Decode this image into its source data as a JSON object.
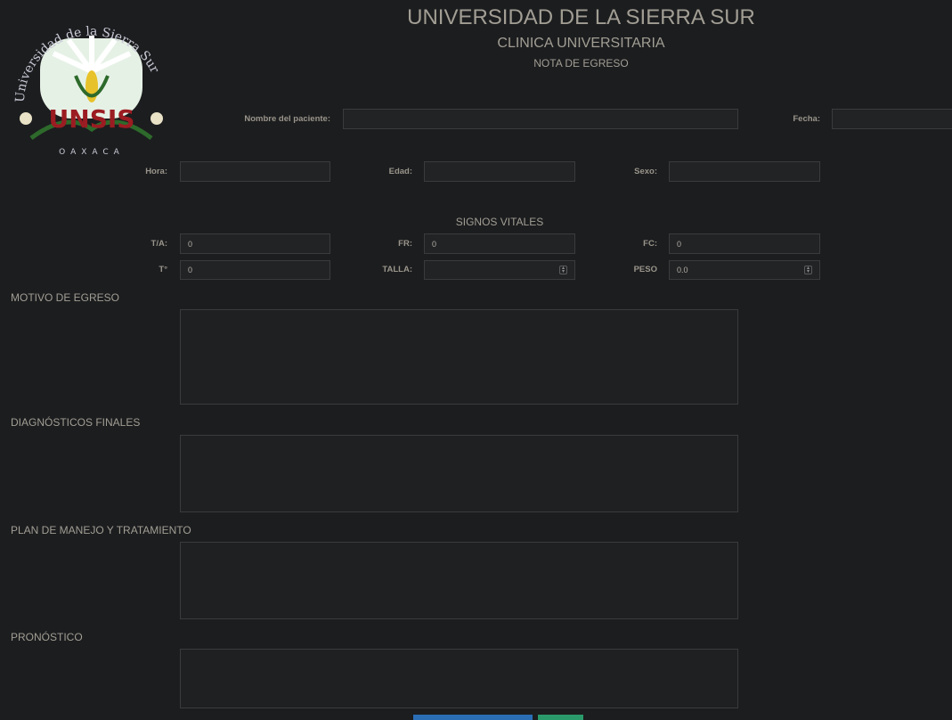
{
  "header": {
    "title": "UNIVERSIDAD DE LA SIERRA SUR",
    "subtitle": "CLINICA UNIVERSITARIA",
    "note": "NOTA DE EGRESO"
  },
  "logo": {
    "arc_text": "Universidad de la Sierra Sur",
    "name": "UNSIS",
    "bottom_text": "OAXACA"
  },
  "fields": {
    "patient_label": "Nombre del paciente:",
    "patient_value": "",
    "fecha_label": "Fecha:",
    "fecha_value": "",
    "hora_label": "Hora:",
    "edad_label": "Edad:",
    "sexo_label": "Sexo:"
  },
  "vitals": {
    "heading": "SIGNOS VITALES",
    "ta_label": "T/A:",
    "ta_value": "0",
    "fr_label": "FR:",
    "fr_value": "0",
    "fc_label": "FC:",
    "fc_value": "0",
    "t_label": "T°",
    "t_value": "0",
    "talla_label": "TALLA:",
    "talla_value": "",
    "peso_label": "PESO",
    "peso_value": "0.0"
  },
  "sections": {
    "motivo": "MOTIVO DE EGRESO",
    "diagnosticos": "DIAGNÓSTICOS FINALES",
    "plan": "PLAN DE MANEJO Y TRATAMIENTO",
    "pronostico": "PRONÓSTICO"
  },
  "colors": {
    "background": "#1c1d1f",
    "primary_button": "#2a6fb5",
    "success_button": "#2b9a6b",
    "logo_red": "#9b1c22"
  }
}
